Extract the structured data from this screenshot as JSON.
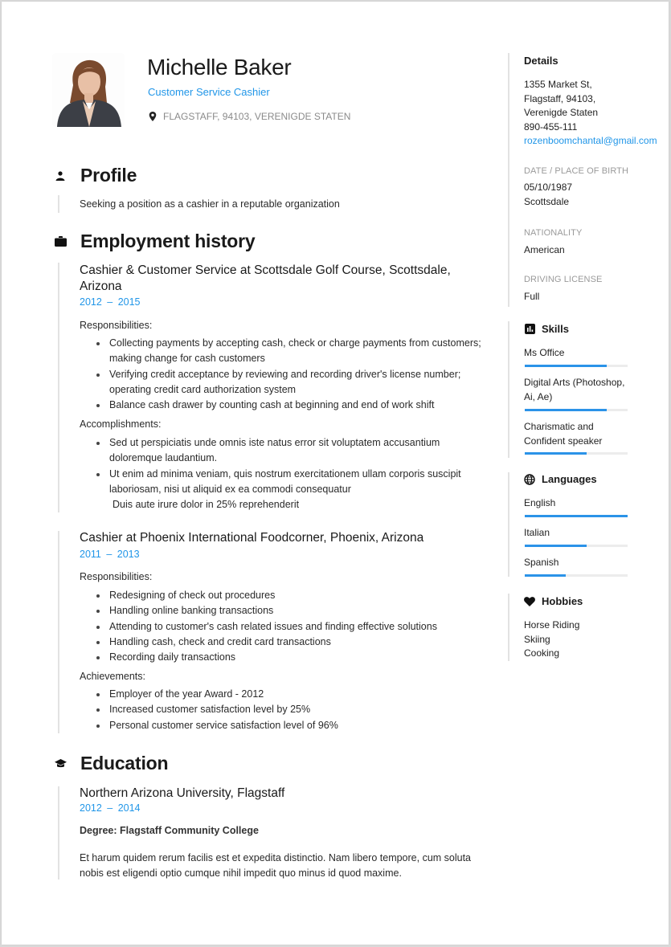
{
  "header": {
    "name": "Michelle Baker",
    "job_title": "Customer Service Cashier",
    "location": "FLAGSTAFF, 94103, VERENIGDE STATEN",
    "photo_icon": "profile-photo"
  },
  "profile": {
    "heading": "Profile",
    "icon": "person-icon",
    "text": "Seeking a position as a cashier in a reputable organization"
  },
  "employment": {
    "heading": "Employment history",
    "icon": "briefcase-icon",
    "jobs": [
      {
        "title": "Cashier & Customer Service at Scottsdale Golf Course, Scottsdale, Arizona",
        "dates": "2012 – 2015",
        "groups": [
          {
            "label": "Responsibilities:",
            "items": [
              "Collecting payments by accepting cash, check or charge payments from customers; making change for cash customers",
              "Verifying credit acceptance by reviewing and recording driver's license number; operating credit card authorization system",
              "Balance cash drawer by counting cash at beginning and end of work shift"
            ]
          },
          {
            "label": "Accomplishments:",
            "items": [
              "Sed ut perspiciatis unde omnis iste natus error sit voluptatem accusantium doloremque laudantium.",
              "Ut enim ad minima veniam, quis nostrum exercitationem ullam corporis suscipit laboriosam, nisi ut aliquid ex ea commodi consequatur"
            ],
            "trailing": "Duis aute irure dolor in 25% reprehenderit"
          }
        ]
      },
      {
        "title": "Cashier at Phoenix International Foodcorner, Phoenix, Arizona",
        "dates": "2011 – 2013",
        "groups": [
          {
            "label": "Responsibilities:",
            "items": [
              "Redesigning of check out procedures",
              "Handling online banking transactions",
              "Attending to customer's cash related issues and finding effective solutions",
              "Handling cash, check and credit card transactions",
              "Recording daily transactions"
            ]
          },
          {
            "label": "Achievements:",
            "items": [
              "Employer of the year Award - 2012",
              "Increased customer satisfaction level by 25%",
              "Personal customer service satisfaction level of 96%"
            ]
          }
        ]
      }
    ]
  },
  "education": {
    "heading": "Education",
    "icon": "graduation-cap-icon",
    "entries": [
      {
        "title": "Northern Arizona University, Flagstaff",
        "dates": "2012 – 2014",
        "degree": "Degree: Flagstaff Community College",
        "description": "Et harum quidem rerum facilis est et expedita distinctio. Nam libero tempore, cum soluta nobis est eligendi optio cumque nihil impedit quo minus id quod maxime."
      }
    ]
  },
  "sidebar": {
    "details": {
      "heading": "Details",
      "address": [
        "1355 Market St,",
        "Flagstaff, 94103,",
        "Verenigde Staten"
      ],
      "phone": "890-455-111",
      "email": "rozenboomchantal@gmail.com"
    },
    "birth": {
      "label": "DATE / PLACE OF BIRTH",
      "date": "05/10/1987",
      "place": "Scottsdale"
    },
    "nationality": {
      "label": "NATIONALITY",
      "value": "American"
    },
    "driving_license": {
      "label": "DRIVING LICENSE",
      "value": "Full"
    },
    "skills": {
      "heading": "Skills",
      "icon": "bar-chart-icon",
      "items": [
        {
          "name": "Ms Office",
          "level": 0.8
        },
        {
          "name": "Digital Arts (Photoshop, Ai, Ae)",
          "level": 0.8
        },
        {
          "name": "Charismatic and Confident speaker",
          "level": 0.6
        }
      ]
    },
    "languages": {
      "heading": "Languages",
      "icon": "globe-icon",
      "items": [
        {
          "name": "English",
          "level": 1.0
        },
        {
          "name": "Italian",
          "level": 0.6
        },
        {
          "name": "Spanish",
          "level": 0.4
        }
      ]
    },
    "hobbies": {
      "heading": "Hobbies",
      "icon": "heart-icon",
      "items": [
        "Horse Riding",
        "Skiing",
        "Cooking"
      ]
    }
  },
  "colors": {
    "accent": "#2196e8",
    "bar_track": "#ececec",
    "muted": "#9a9a9a"
  }
}
